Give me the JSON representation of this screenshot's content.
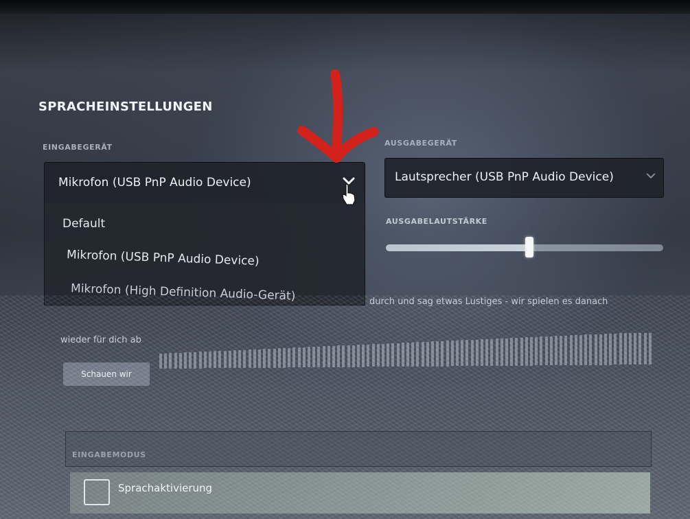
{
  "settings": {
    "title": "SPRACHEINSTELLUNGEN",
    "input_device": {
      "label": "EINGABEGERÄT",
      "selected": "Mikrofon (USB PnP Audio Device)",
      "options": [
        "Default",
        "Mikrofon (USB PnP Audio Device)",
        "Mikrofon (High Definition Audio-Gerät)"
      ]
    },
    "output_device": {
      "label": "AUSGABEGERÄT",
      "selected": "Lautsprecher (USB PnP Audio Device)"
    },
    "output_volume": {
      "label": "AUSGABELAUTSTÄRKE",
      "level_fraction": 0.5
    },
    "mic_test": {
      "description_line1": "durch und sag etwas Lustiges - wir spielen es danach",
      "description_line2": "wieder für dich ab",
      "button_label": "Schauen wir"
    },
    "input_mode": {
      "label": "EINGABEMODUS",
      "voice_activation_label": "Sprachaktivierung"
    }
  },
  "icons": {
    "dropdown_arrow": "chevron-down-icon",
    "cursor": "hand-pointer-icon",
    "annotation": "red-arrow-icon"
  },
  "colors": {
    "annotation_red": "#d3221c",
    "panel_bg": "#20232a",
    "text_primary": "#eef1f6"
  }
}
